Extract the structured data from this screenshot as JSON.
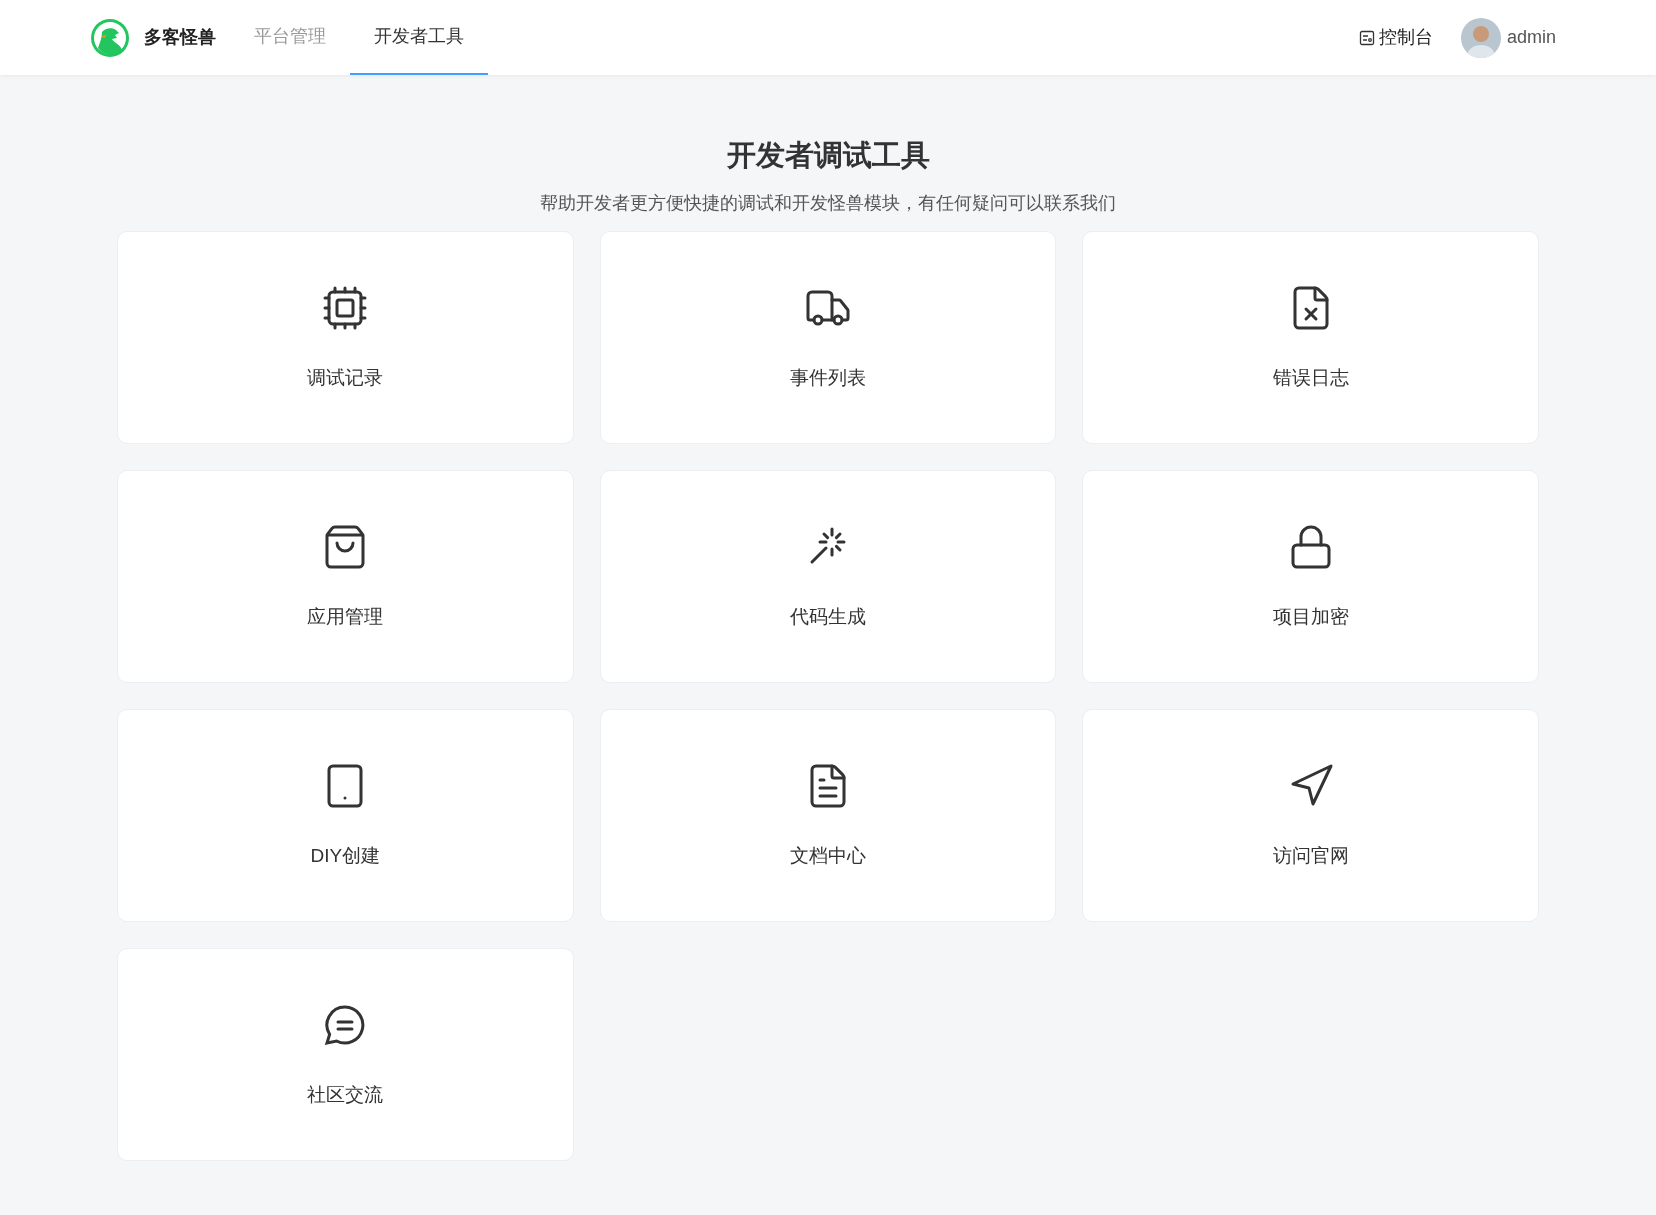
{
  "header": {
    "brand": "多客怪兽",
    "nav": [
      {
        "label": "平台管理",
        "selected": false
      },
      {
        "label": "开发者工具",
        "selected": true
      }
    ],
    "console": "控制台",
    "user": "admin"
  },
  "page": {
    "title": "开发者调试工具",
    "subtitle": "帮助开发者更方便快捷的调试和开发怪兽模块，有任何疑问可以联系我们"
  },
  "tools": [
    {
      "label": "调试记录"
    },
    {
      "label": "事件列表"
    },
    {
      "label": "错误日志"
    },
    {
      "label": "应用管理"
    },
    {
      "label": "代码生成"
    },
    {
      "label": "项目加密"
    },
    {
      "label": "DIY创建"
    },
    {
      "label": "文档中心"
    },
    {
      "label": "访问官网"
    },
    {
      "label": "社区交流"
    }
  ]
}
